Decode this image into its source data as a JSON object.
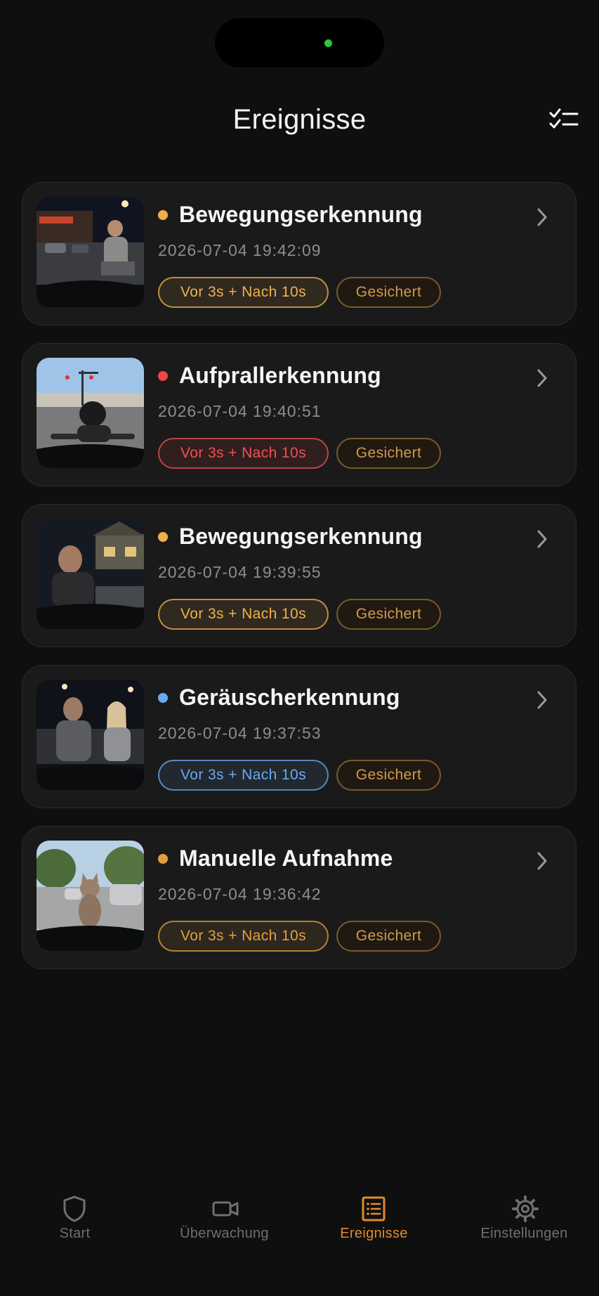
{
  "header": {
    "title": "Ereignisse",
    "select_icon": "checklist-icon"
  },
  "events": [
    {
      "title": "Bewegungserkennung",
      "timestamp": "2026-07-04 19:42:09",
      "window": "Vor 3s + Nach 10s",
      "status": "Gesichert",
      "dot_color": "#f0b14a",
      "chip_color": "#f0b14a"
    },
    {
      "title": "Aufprallerkennung",
      "timestamp": "2026-07-04 19:40:51",
      "window": "Vor 3s + Nach 10s",
      "status": "Gesichert",
      "dot_color": "#f04848",
      "chip_color": "#f05050"
    },
    {
      "title": "Bewegungserkennung",
      "timestamp": "2026-07-04 19:39:55",
      "window": "Vor 3s + Nach 10s",
      "status": "Gesichert",
      "dot_color": "#f0b14a",
      "chip_color": "#f0b14a"
    },
    {
      "title": "Geräuscherkennung",
      "timestamp": "2026-07-04 19:37:53",
      "window": "Vor 3s + Nach 10s",
      "status": "Gesichert",
      "dot_color": "#6aa9ef",
      "chip_color": "#6aa9ef"
    },
    {
      "title": "Manuelle Aufnahme",
      "timestamp": "2026-07-04 19:36:42",
      "window": "Vor 3s + Nach 10s",
      "status": "Gesichert",
      "dot_color": "#e0a040",
      "chip_color": "#e0a040"
    }
  ],
  "tabbar": {
    "items": [
      {
        "label": "Start",
        "icon": "shield-icon"
      },
      {
        "label": "Überwachung",
        "icon": "video-camera-icon"
      },
      {
        "label": "Ereignisse",
        "icon": "event-list-icon",
        "active": true
      },
      {
        "label": "Einstellungen",
        "icon": "gear-icon"
      }
    ],
    "active_color": "#e08b2f"
  }
}
